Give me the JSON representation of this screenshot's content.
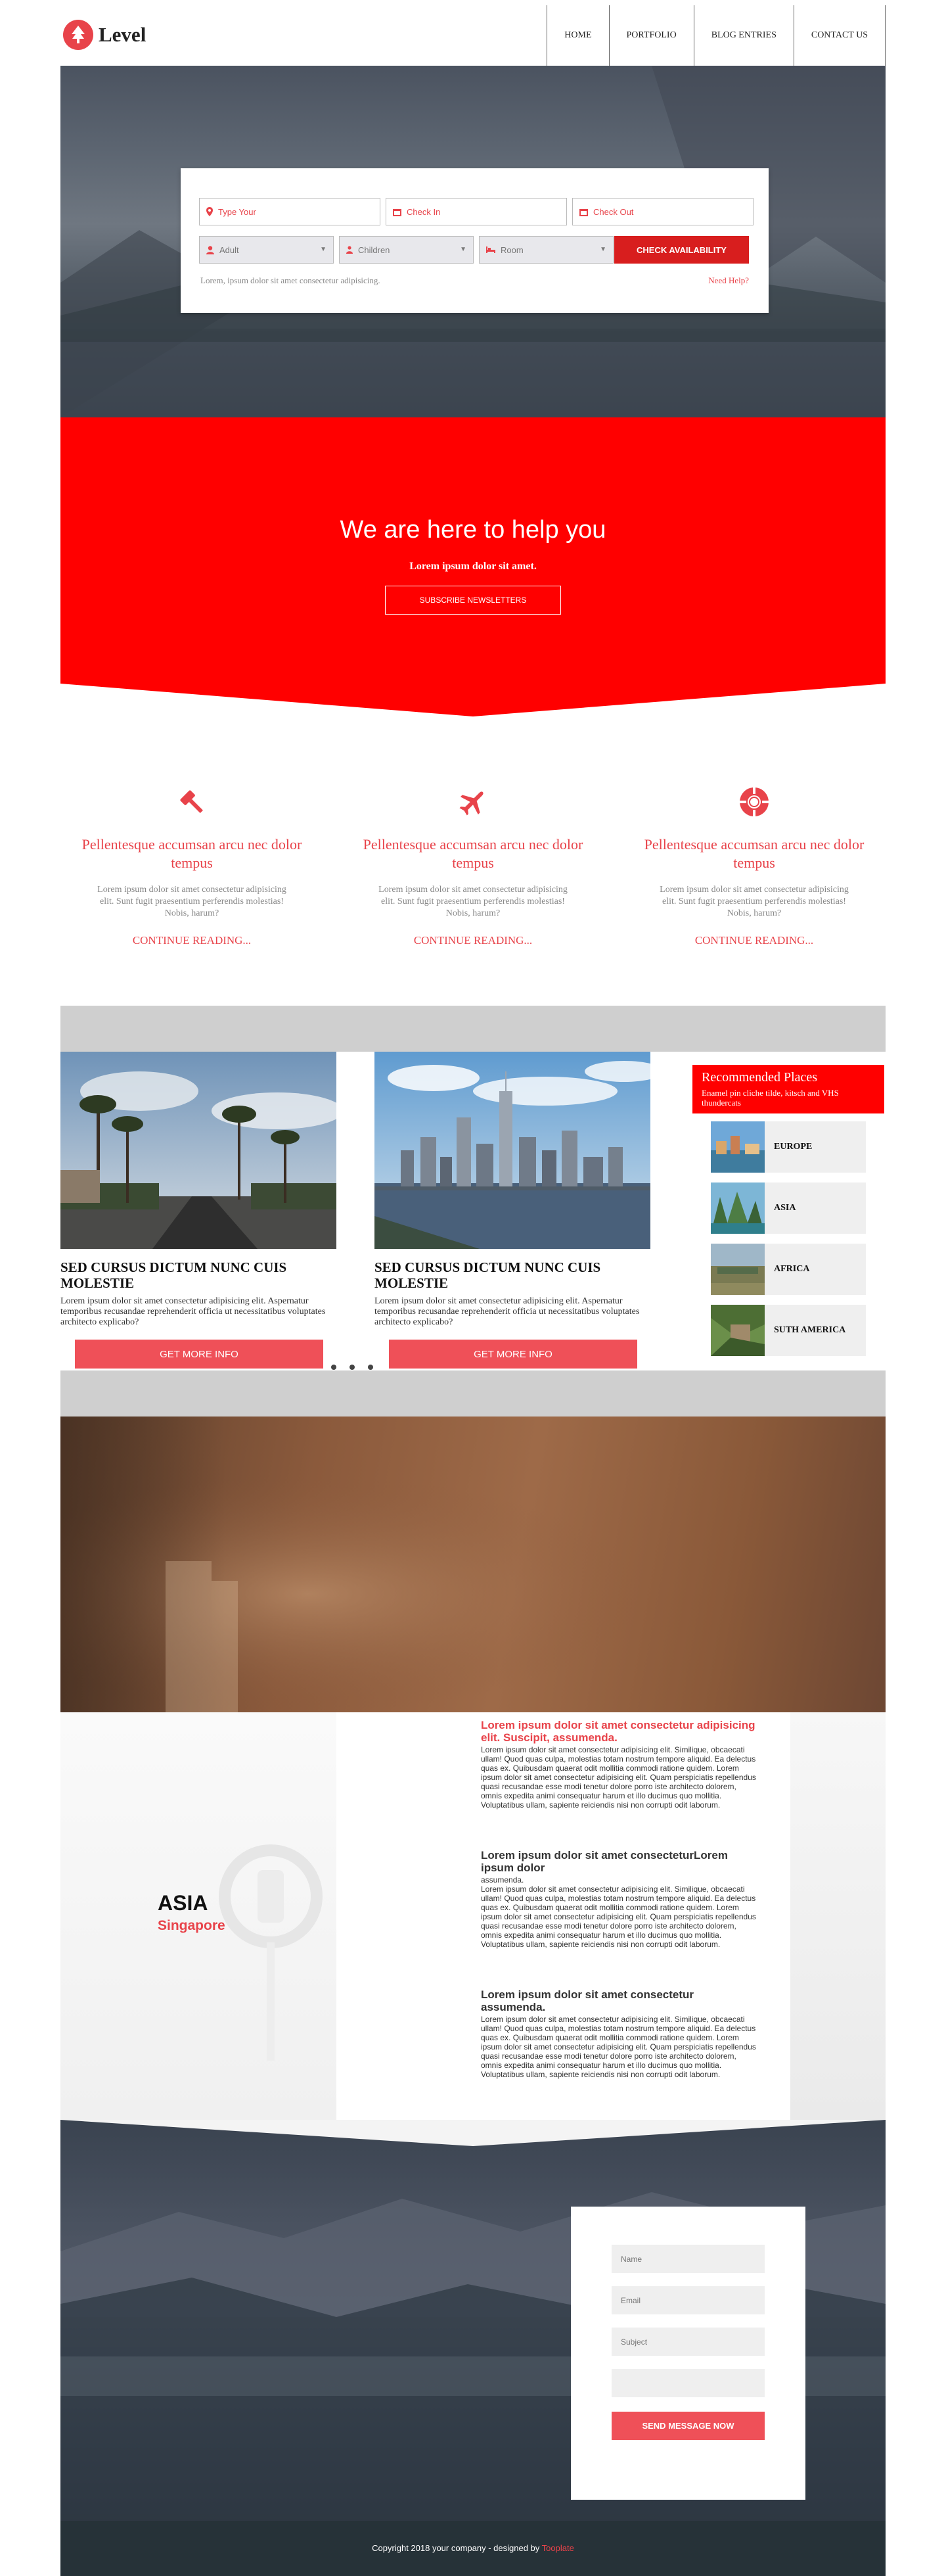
{
  "header": {
    "logo_text": "Level",
    "nav": [
      "HOME",
      "PORTFOLIO",
      "BLOG ENTRIES",
      "CONTACT US"
    ]
  },
  "booking": {
    "location_placeholder": "Type Your",
    "checkin_placeholder": "Check In",
    "checkout_placeholder": "Check Out",
    "adult_label": "Adult",
    "children_label": "Children",
    "room_label": "Room",
    "check_button": "CHECK AVAILABILITY",
    "note": "Lorem, ipsum dolor sit amet consectetur adipisicing.",
    "help_link": "Need Help?"
  },
  "band": {
    "title": "We are here to help you",
    "subtitle": "Lorem ipsum dolor sit amet.",
    "button": "SUBSCRIBE NEWSLETTERS"
  },
  "features": [
    {
      "icon": "gavel-icon",
      "title": "Pellentesque accumsan arcu nec dolor tempus",
      "text": "Lorem ipsum dolor sit amet consectetur adipisicing elit. Sunt fugit praesentium perferendis molestias! Nobis, harum?",
      "link": "CONTINUE READING..."
    },
    {
      "icon": "plane-icon",
      "title": "Pellentesque accumsan arcu nec dolor tempus",
      "text": "Lorem ipsum dolor sit amet consectetur adipisicing elit. Sunt fugit praesentium perferendis molestias! Nobis, harum?",
      "link": "CONTINUE READING..."
    },
    {
      "icon": "lifebuoy-icon",
      "title": "Pellentesque accumsan arcu nec dolor tempus",
      "text": "Lorem ipsum dolor sit amet consectetur adipisicing elit. Sunt fugit praesentium perferendis molestias! Nobis, harum?",
      "link": "CONTINUE READING..."
    }
  ],
  "posts": [
    {
      "title": "SED CURSUS DICTUM NUNC CUIS MOLESTIE",
      "text": "Lorem ipsum dolor sit amet consectetur adipisicing elit. Aspernatur temporibus recusandae reprehenderit officia ut necessitatibus voluptates architecto explicabo?",
      "button": "GET MORE INFO"
    },
    {
      "title": "SED CURSUS DICTUM NUNC CUIS MOLESTIE",
      "text": "Lorem ipsum dolor sit amet consectetur adipisicing elit. Aspernatur temporibus recusandae reprehenderit officia ut necessitatibus voluptates architecto explicabo?",
      "button": "GET MORE INFO"
    }
  ],
  "recommended": {
    "title": "Recommended Places",
    "subtitle": "Enamel pin cliche tilde, kitsch and VHS thundercats",
    "items": [
      "EUROPE",
      "ASIA",
      "AFRICA",
      "SUTH AMERICA"
    ]
  },
  "asia": {
    "title": "ASIA",
    "subtitle": "Singapore",
    "blocks": [
      {
        "heading": "Lorem ipsum dolor sit amet consectetur adipisicing elit. Suscipit, assumenda.",
        "sub": "",
        "text": "Lorem ipsum dolor sit amet consectetur adipisicing elit. Similique, obcaecati ullam! Quod quas culpa, molestias totam nostrum tempore aliquid. Ea delectus quas ex. Quibusdam quaerat odit mollitia commodi ratione quidem. Lorem ipsum dolor sit amet consectetur adipisicing elit. Quam perspiciatis repellendus quasi recusandae esse modi tenetur dolore porro iste architecto dolorem, omnis expedita animi consequatur harum et illo ducimus quo mollitia. Voluptatibus ullam, sapiente reiciendis nisi non corrupti odit laborum."
      },
      {
        "heading": "Lorem ipsum dolor sit amet consecteturLorem ipsum dolor",
        "sub": "assumenda.",
        "text": "Lorem ipsum dolor sit amet consectetur adipisicing elit. Similique, obcaecati ullam! Quod quas culpa, molestias totam nostrum tempore aliquid. Ea delectus quas ex. Quibusdam quaerat odit mollitia commodi ratione quidem. Lorem ipsum dolor sit amet consectetur adipisicing elit. Quam perspiciatis repellendus quasi recusandae esse modi tenetur dolore porro iste architecto dolorem, omnis expedita animi consequatur harum et illo ducimus quo mollitia. Voluptatibus ullam, sapiente reiciendis nisi non corrupti odit laborum."
      },
      {
        "heading": "Lorem ipsum dolor sit amet consectetur assumenda.",
        "sub": "",
        "text": "Lorem ipsum dolor sit amet consectetur adipisicing elit. Similique, obcaecati ullam! Quod quas culpa, molestias totam nostrum tempore aliquid. Ea delectus quas ex. Quibusdam quaerat odit mollitia commodi ratione quidem. Lorem ipsum dolor sit amet consectetur adipisicing elit. Quam perspiciatis repellendus quasi recusandae esse modi tenetur dolore porro iste architecto dolorem, omnis expedita animi consequatur harum et illo ducimus quo mollitia. Voluptatibus ullam, sapiente reiciendis nisi non corrupti odit laborum."
      }
    ]
  },
  "contact": {
    "name_placeholder": "Name",
    "email_placeholder": "Email",
    "subject_placeholder": "Subject",
    "send_button": "SEND MESSAGE NOW"
  },
  "footer": {
    "copyright": "Copyright 2018 your company - designed by ",
    "designer": "Tooplate"
  },
  "colors": {
    "accent": "#e8434a",
    "band": "#ff0000",
    "button": "#ef5058",
    "footer": "#263238"
  }
}
